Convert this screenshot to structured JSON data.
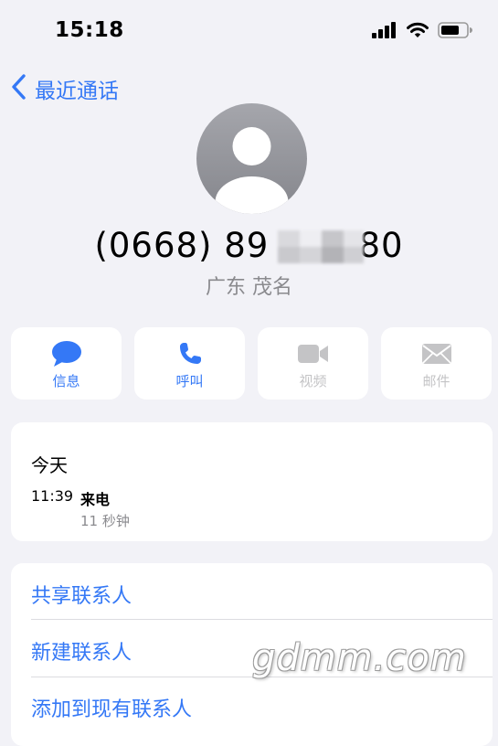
{
  "status_bar": {
    "time": "15:18",
    "icons": [
      "signal-icon",
      "wifi-icon",
      "battery-icon"
    ]
  },
  "nav": {
    "back_label": "最近通话"
  },
  "contact": {
    "number": "(0668) 89    80",
    "location": "广东 茂名"
  },
  "actions": [
    {
      "label": "信息",
      "icon": "message-icon",
      "enabled": true
    },
    {
      "label": "呼叫",
      "icon": "phone-icon",
      "enabled": true
    },
    {
      "label": "视频",
      "icon": "video-icon",
      "enabled": false
    },
    {
      "label": "邮件",
      "icon": "mail-icon",
      "enabled": false
    }
  ],
  "history": {
    "date": "今天",
    "time": "11:39",
    "type": "来电",
    "duration": "11 秒钟"
  },
  "options": [
    "共享联系人",
    "新建联系人",
    "添加到现有联系人"
  ],
  "watermark": "gdmm.com",
  "colors": {
    "accent": "#3478f6",
    "background": "#f2f2f7",
    "card": "#ffffff",
    "secondary_text": "#8a8a8e",
    "disabled": "#c4c4c6"
  }
}
